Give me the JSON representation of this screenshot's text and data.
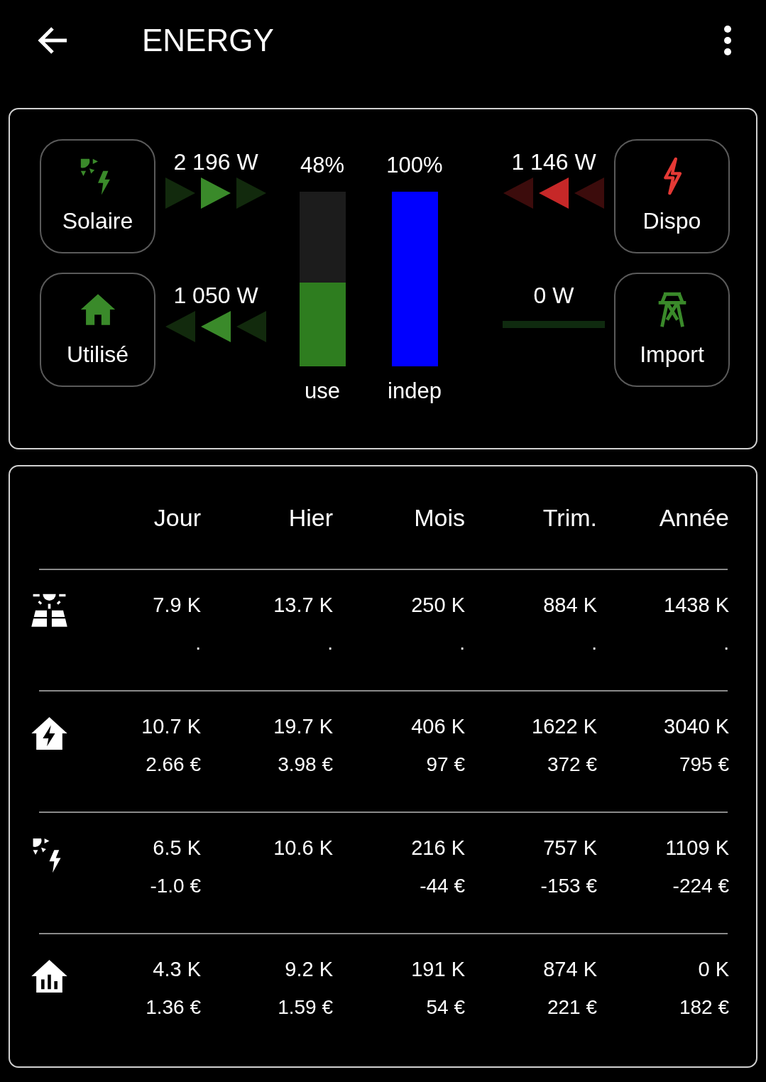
{
  "app_bar": {
    "title": "ENERGY"
  },
  "flow_card": {
    "sources": [
      {
        "label": "Solaire",
        "kind": "solar-power",
        "color": "#3a8a2a",
        "flow": {
          "value": "2 196 W",
          "kind": "arrows-right",
          "color": "#3a8a2a"
        }
      },
      {
        "label": "Utilisé",
        "kind": "house",
        "color": "#3a8a2a",
        "flow": {
          "value": "1 050 W",
          "kind": "arrows-left",
          "color": "#3a8a2a"
        }
      }
    ],
    "bars": [
      {
        "reading": "48%",
        "label": "use",
        "level": 0.48,
        "color": "#2e7d1f"
      },
      {
        "reading": "100%",
        "label": "indep",
        "level": 1.0,
        "color": "#0000ff"
      }
    ],
    "grid": [
      {
        "label": "Dispo",
        "kind": "bolt",
        "color": "#e53935",
        "flow": {
          "value": "1 146 W",
          "kind": "arrows-left",
          "color": "#c62828"
        }
      },
      {
        "label": "Import",
        "kind": "tower",
        "color": "#3a8a2a",
        "flow": {
          "value": "0 W",
          "kind": "line",
          "color": "#0f2a0f"
        }
      }
    ]
  },
  "table": {
    "columns": [
      "Jour",
      "Hier",
      "Mois",
      "Trim.",
      "Année"
    ],
    "rows": [
      {
        "kind": "solar-panel",
        "cells": [
          {
            "value": "7.9 K",
            "cost": "."
          },
          {
            "value": "13.7 K",
            "cost": "."
          },
          {
            "value": "250 K",
            "cost": "."
          },
          {
            "value": "884 K",
            "cost": "."
          },
          {
            "value": "1438 K",
            "cost": "."
          }
        ]
      },
      {
        "kind": "house-bolt",
        "cells": [
          {
            "value": "10.7 K",
            "cost": "2.66 €"
          },
          {
            "value": "19.7 K",
            "cost": "3.98 €"
          },
          {
            "value": "406 K",
            "cost": "97 €"
          },
          {
            "value": "1622 K",
            "cost": "372 €"
          },
          {
            "value": "3040 K",
            "cost": "795 €"
          }
        ]
      },
      {
        "kind": "solar-power",
        "cells": [
          {
            "value": "6.5 K",
            "cost": "-1.0 €"
          },
          {
            "value": "10.6 K"
          },
          {
            "value": "216 K",
            "cost": "-44 €"
          },
          {
            "value": "757 K",
            "cost": "-153 €"
          },
          {
            "value": "1109 K",
            "cost": "-224 €"
          }
        ]
      },
      {
        "kind": "house-chart",
        "cells": [
          {
            "value": "4.3 K",
            "cost": "1.36 €"
          },
          {
            "value": "9.2 K",
            "cost": "1.59 €"
          },
          {
            "value": "191 K",
            "cost": "54 €"
          },
          {
            "value": "874 K",
            "cost": "221 €"
          },
          {
            "value": "0 K",
            "cost": "182 €"
          }
        ]
      }
    ]
  }
}
